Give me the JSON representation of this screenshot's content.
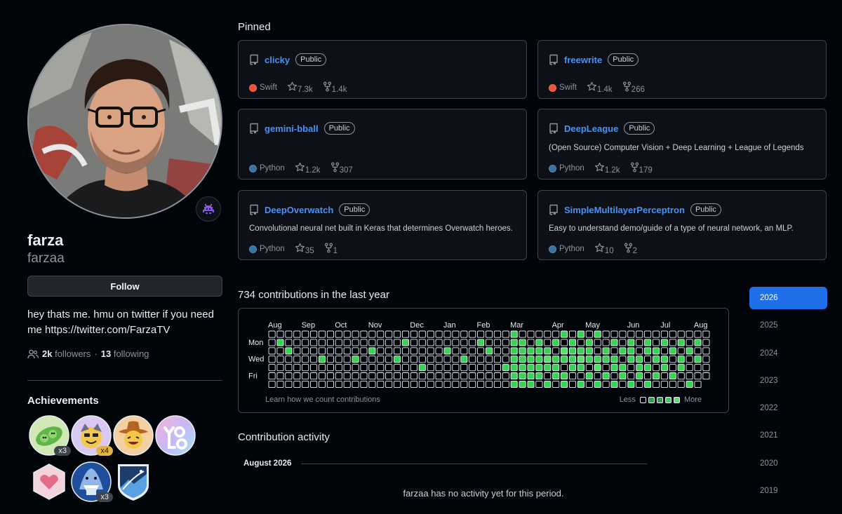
{
  "profile": {
    "name": "farza",
    "login": "farzaa",
    "follow_label": "Follow",
    "bio": "hey thats me. hmu on twitter if you need me https://twitter.com/FarzaTV",
    "followers_count": "2k",
    "followers_label": "followers",
    "separator": "·",
    "following_count": "13",
    "following_label": "following",
    "status_icon": "space-invader-icon"
  },
  "achievements": {
    "title": "Achievements",
    "badges": [
      {
        "icon": "pair-extraordinaire-icon",
        "count": "x3"
      },
      {
        "icon": "quickdraw-icon",
        "count": "x4"
      },
      {
        "icon": "yolo-cowboy-icon",
        "count": ""
      },
      {
        "icon": "yolo-icon",
        "count": ""
      },
      {
        "icon": "heart-sponsor-icon",
        "count": ""
      },
      {
        "icon": "shark-icon",
        "count": "x3"
      },
      {
        "icon": "arctic-code-vault-icon",
        "count": ""
      }
    ]
  },
  "pinned": {
    "title": "Pinned",
    "repos": [
      {
        "name": "clicky",
        "visibility": "Public",
        "description": "",
        "language": "Swift",
        "language_color": "#F05138",
        "stars": "7.3k",
        "forks": "1.4k"
      },
      {
        "name": "freewrite",
        "visibility": "Public",
        "description": "",
        "language": "Swift",
        "language_color": "#F05138",
        "stars": "1.4k",
        "forks": "266"
      },
      {
        "name": "gemini-bball",
        "visibility": "Public",
        "description": "",
        "language": "Python",
        "language_color": "#3572A5",
        "stars": "1.2k",
        "forks": "307"
      },
      {
        "name": "DeepLeague",
        "visibility": "Public",
        "description": "(Open Source) Computer Vision + Deep Learning + League of Legends",
        "language": "Python",
        "language_color": "#3572A5",
        "stars": "1.2k",
        "forks": "179"
      },
      {
        "name": "DeepOverwatch",
        "visibility": "Public",
        "description": "Convolutional neural net built in Keras that determines Overwatch heroes.",
        "language": "Python",
        "language_color": "#3572A5",
        "stars": "35",
        "forks": "1"
      },
      {
        "name": "SimpleMultilayerPerceptron",
        "visibility": "Public",
        "description": "Easy to understand demo/guide of a type of neural network, an MLP.",
        "language": "Python",
        "language_color": "#3572A5",
        "stars": "10",
        "forks": "2"
      }
    ]
  },
  "contributions": {
    "title": "734 contributions in the last year",
    "months": [
      "Aug",
      "Sep",
      "Oct",
      "Nov",
      "Dec",
      "Jan",
      "Feb",
      "Mar",
      "Apr",
      "May",
      "Jun",
      "Jul",
      "Aug"
    ],
    "month_weeks": [
      0,
      4,
      8,
      12,
      17,
      21,
      25,
      29,
      34,
      38,
      43,
      47,
      51
    ],
    "day_labels": [
      {
        "row": 1,
        "label": "Mon"
      },
      {
        "row": 3,
        "label": "Wed"
      },
      {
        "row": 5,
        "label": "Fri"
      }
    ],
    "weeks": 53,
    "active_cells": [
      [
        1,
        1
      ],
      [
        2,
        2
      ],
      [
        6,
        3
      ],
      [
        10,
        3
      ],
      [
        12,
        2
      ],
      [
        15,
        3
      ],
      [
        16,
        1
      ],
      [
        18,
        4
      ],
      [
        21,
        2
      ],
      [
        23,
        3
      ],
      [
        25,
        1
      ],
      [
        26,
        2
      ],
      [
        28,
        4
      ],
      [
        29,
        0
      ],
      [
        29,
        1
      ],
      [
        29,
        2
      ],
      [
        29,
        3
      ],
      [
        29,
        4
      ],
      [
        29,
        5
      ],
      [
        29,
        6
      ],
      [
        30,
        1
      ],
      [
        30,
        2
      ],
      [
        30,
        3
      ],
      [
        30,
        4
      ],
      [
        30,
        5
      ],
      [
        30,
        6
      ],
      [
        31,
        2
      ],
      [
        31,
        3
      ],
      [
        31,
        4
      ],
      [
        31,
        5
      ],
      [
        31,
        6
      ],
      [
        32,
        1
      ],
      [
        32,
        2
      ],
      [
        32,
        3
      ],
      [
        32,
        4
      ],
      [
        32,
        5
      ],
      [
        33,
        2
      ],
      [
        33,
        3
      ],
      [
        33,
        4
      ],
      [
        33,
        6
      ],
      [
        34,
        1
      ],
      [
        34,
        3
      ],
      [
        34,
        4
      ],
      [
        34,
        5
      ],
      [
        35,
        0
      ],
      [
        35,
        2
      ],
      [
        35,
        3
      ],
      [
        35,
        5
      ],
      [
        35,
        6
      ],
      [
        36,
        1
      ],
      [
        36,
        2
      ],
      [
        36,
        3
      ],
      [
        36,
        4
      ],
      [
        37,
        0
      ],
      [
        37,
        2
      ],
      [
        37,
        3
      ],
      [
        37,
        4
      ],
      [
        37,
        6
      ],
      [
        38,
        1
      ],
      [
        38,
        2
      ],
      [
        38,
        3
      ],
      [
        38,
        5
      ],
      [
        39,
        0
      ],
      [
        39,
        3
      ],
      [
        39,
        4
      ],
      [
        39,
        6
      ],
      [
        40,
        2
      ],
      [
        40,
        3
      ],
      [
        40,
        5
      ],
      [
        41,
        1
      ],
      [
        41,
        3
      ],
      [
        41,
        4
      ],
      [
        41,
        6
      ],
      [
        42,
        2
      ],
      [
        42,
        4
      ],
      [
        42,
        5
      ],
      [
        43,
        1
      ],
      [
        43,
        2
      ],
      [
        43,
        3
      ],
      [
        43,
        6
      ],
      [
        44,
        3
      ],
      [
        44,
        4
      ],
      [
        44,
        5
      ],
      [
        45,
        1
      ],
      [
        45,
        2
      ],
      [
        45,
        4
      ],
      [
        45,
        6
      ],
      [
        46,
        2
      ],
      [
        46,
        3
      ],
      [
        46,
        5
      ],
      [
        47,
        1
      ],
      [
        47,
        3
      ],
      [
        47,
        4
      ],
      [
        48,
        2
      ],
      [
        48,
        5
      ],
      [
        49,
        1
      ],
      [
        49,
        3
      ],
      [
        49,
        4
      ],
      [
        50,
        2
      ],
      [
        50,
        6
      ],
      [
        51,
        1
      ],
      [
        51,
        3
      ]
    ],
    "bright_cells": [
      [
        33,
        3
      ],
      [
        35,
        2
      ],
      [
        37,
        3
      ],
      [
        39,
        4
      ]
    ],
    "last_week_days": 6,
    "learn_label": "Learn how we count contributions",
    "legend_less": "Less",
    "legend_more": "More",
    "colors": {
      "empty": "#010409",
      "empty_border": "#e6edf3",
      "level": "#39d353",
      "level_dim": "#26a641"
    }
  },
  "years": [
    "2026",
    "2025",
    "2024",
    "2023",
    "2022",
    "2021",
    "2020",
    "2019"
  ],
  "active_year": "2026",
  "activity": {
    "title": "Contribution activity",
    "month_label": "August 2026",
    "empty_message": "farzaa has no activity yet for this period."
  },
  "colors": {
    "background": "#010409",
    "card_border": "#3d444d",
    "link_blue": "#4493f8",
    "year_active": "#1f6feb"
  }
}
